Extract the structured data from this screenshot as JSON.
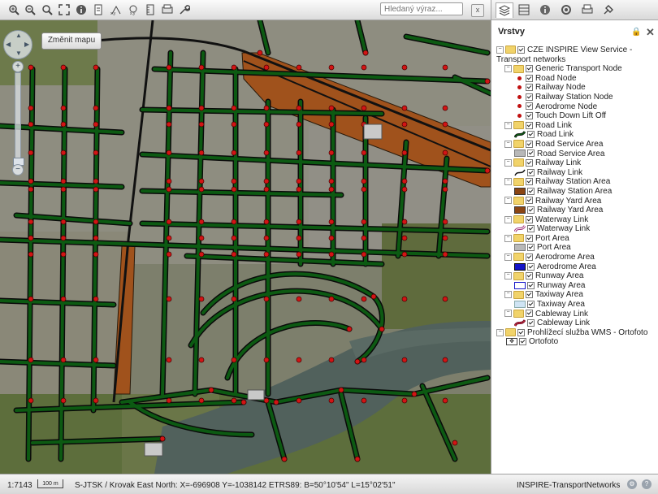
{
  "toolbar": {
    "buttons": [
      "zoom-in-icon",
      "zoom-out-icon",
      "zoom-box-icon",
      "full-extent-icon",
      "info-icon",
      "print-icon",
      "prev-extent-icon",
      "next-extent-icon",
      "measure-icon",
      "export-icon",
      "settings-icon"
    ],
    "search_placeholder": "Hledaný výraz...",
    "search_clear": "x"
  },
  "map": {
    "change_map_label": "Změnit mapu",
    "zoom_plus": "+",
    "zoom_minus": "−",
    "colors": {
      "road": "#0c5a12",
      "road_outline": "#101010",
      "node": "#d21414",
      "railway_yard": "#a0521c",
      "water": "#51615c",
      "urban": "#8d8b7c",
      "green": "#5c7238"
    }
  },
  "panel": {
    "tabs": [
      "layers-tab",
      "legend-tab",
      "info-tab",
      "search-tab",
      "print-tab",
      "tools-tab"
    ],
    "title": "Vrstvy",
    "lock": "🔒",
    "close": "✕",
    "tree": [
      {
        "level": 0,
        "label": "CZE INSPIRE View Service - Transport networks",
        "type": "group"
      },
      {
        "level": 1,
        "label": "Generic Transport Node",
        "type": "group"
      },
      {
        "level": 2,
        "label": "Road Node",
        "type": "dot"
      },
      {
        "level": 2,
        "label": "Railway Node",
        "type": "dot"
      },
      {
        "level": 2,
        "label": "Railway Station Node",
        "type": "dot"
      },
      {
        "level": 2,
        "label": "Aerodrome Node",
        "type": "dot"
      },
      {
        "level": 2,
        "label": "Touch Down Lift Off",
        "type": "dot"
      },
      {
        "level": 1,
        "label": "Road Link",
        "type": "group"
      },
      {
        "level": 2,
        "label": "Road Link",
        "type": "road"
      },
      {
        "level": 1,
        "label": "Road Service Area",
        "type": "group"
      },
      {
        "level": 2,
        "label": "Road Service Area",
        "type": "grey"
      },
      {
        "level": 1,
        "label": "Railway Link",
        "type": "group"
      },
      {
        "level": 2,
        "label": "Railway Link",
        "type": "rail"
      },
      {
        "level": 1,
        "label": "Railway Station Area",
        "type": "group"
      },
      {
        "level": 2,
        "label": "Railway Station Area",
        "type": "brown"
      },
      {
        "level": 1,
        "label": "Railway Yard Area",
        "type": "group"
      },
      {
        "level": 2,
        "label": "Railway Yard Area",
        "type": "brown"
      },
      {
        "level": 1,
        "label": "Waterway Link",
        "type": "group"
      },
      {
        "level": 2,
        "label": "Waterway Link",
        "type": "waterway"
      },
      {
        "level": 1,
        "label": "Port Area",
        "type": "group"
      },
      {
        "level": 2,
        "label": "Port Area",
        "type": "grey"
      },
      {
        "level": 1,
        "label": "Aerodrome Area",
        "type": "group"
      },
      {
        "level": 2,
        "label": "Aerodrome Area",
        "type": "blue"
      },
      {
        "level": 1,
        "label": "Runway Area",
        "type": "group"
      },
      {
        "level": 2,
        "label": "Runway Area",
        "type": "outline"
      },
      {
        "level": 1,
        "label": "Taxiway Area",
        "type": "group"
      },
      {
        "level": 2,
        "label": "Taxiway Area",
        "type": "lightblue"
      },
      {
        "level": 1,
        "label": "Cableway Link",
        "type": "group"
      },
      {
        "level": 2,
        "label": "Cableway Link",
        "type": "cableway"
      },
      {
        "level": 0,
        "label": "Prohlížecí služba WMS - Ortofoto",
        "type": "group"
      },
      {
        "level": 1,
        "label": "Ortofoto",
        "type": "ortho"
      }
    ]
  },
  "status": {
    "scale": "1:7143",
    "scale_bar": "100 m",
    "crs": "S-JTSK / Krovak East North: X=-696908 Y=-1038142  ETRS89: B=50°10'54\"  L=15°02'51\"",
    "service": "INSPIRE-TransportNetworks"
  }
}
